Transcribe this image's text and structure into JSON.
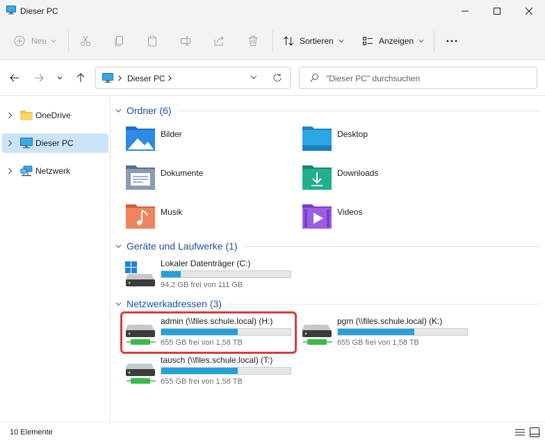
{
  "window": {
    "title": "Dieser PC"
  },
  "toolbar": {
    "new_label": "Neu",
    "sort_label": "Sortieren",
    "view_label": "Anzeigen",
    "more_label": "…"
  },
  "address": {
    "crumb": "Dieser PC",
    "search_placeholder": "\"Dieser PC\" durchsuchen"
  },
  "sidebar": {
    "items": [
      {
        "label": "OneDrive"
      },
      {
        "label": "Dieser PC"
      },
      {
        "label": "Netzwerk"
      }
    ]
  },
  "groups": {
    "folders_title": "Ordner (6)",
    "devices_title": "Geräte und Laufwerke (1)",
    "network_title": "Netzwerkadressen (3)"
  },
  "folders": [
    {
      "label": "Bilder"
    },
    {
      "label": "Desktop"
    },
    {
      "label": "Dokumente"
    },
    {
      "label": "Downloads"
    },
    {
      "label": "Musik"
    },
    {
      "label": "Videos"
    }
  ],
  "drives": [
    {
      "name": "Lokaler Datenträger (C:)",
      "free": "94,2 GB frei von 111 GB",
      "used_fraction": 0.15
    },
    {
      "name": "admin (\\\\files.schule.local) (H:)",
      "free": "655 GB frei von 1,58 TB",
      "used_fraction": 0.59
    },
    {
      "name": "pgm (\\\\files.schule.local) (K:)",
      "free": "655 GB frei von 1,58 TB",
      "used_fraction": 0.59
    },
    {
      "name": "tausch (\\\\files.schule.local) (T:)",
      "free": "655 GB frei von 1,58 TB",
      "used_fraction": 0.59
    }
  ],
  "status": {
    "count": "10 Elemente"
  },
  "colors": {
    "accent": "#26a0da",
    "group_title": "#1f4e9c",
    "selection": "#cce4f7",
    "highlight": "#d83b3b"
  }
}
